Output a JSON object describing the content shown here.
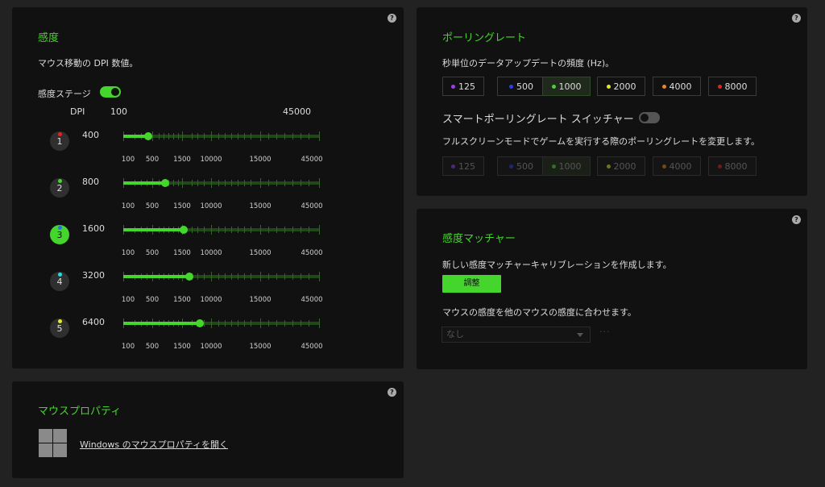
{
  "sensitivity": {
    "title": "感度",
    "description": "マウス移動の DPI 数値。",
    "stages_label": "感度ステージ",
    "stages_enabled": true,
    "dpi_header": "DPI",
    "range_min": "100",
    "range_max": "45000",
    "tick_labels": [
      "100",
      "500",
      "1500",
      "10000",
      "15000",
      "45000"
    ],
    "stages": [
      {
        "number": "1",
        "dpi": "400",
        "color": "#e02424",
        "active": false
      },
      {
        "number": "2",
        "dpi": "800",
        "color": "#44d62c",
        "active": false
      },
      {
        "number": "3",
        "dpi": "1600",
        "color": "#2f6de0",
        "active": true
      },
      {
        "number": "4",
        "dpi": "3200",
        "color": "#2fd6e0",
        "active": false
      },
      {
        "number": "5",
        "dpi": "6400",
        "color": "#e6e62c",
        "active": false
      }
    ]
  },
  "polling": {
    "title": "ポーリングレート",
    "description": "秒単位のデータアップデートの頻度 (Hz)。",
    "rates": [
      {
        "label": "125",
        "color": "#9b3fe6"
      },
      {
        "label": "500",
        "color": "#2f3fe6"
      },
      {
        "label": "1000",
        "color": "#44d62c"
      },
      {
        "label": "2000",
        "color": "#e6e62c"
      },
      {
        "label": "4000",
        "color": "#e6882c"
      },
      {
        "label": "8000",
        "color": "#e02424"
      }
    ],
    "selected": "1000",
    "smart_switcher_label": "スマートポーリングレート スイッチャー",
    "smart_switcher_enabled": false,
    "smart_description": "フルスクリーンモードでゲームを実行する際のポーリングレートを変更します。"
  },
  "matcher": {
    "title": "感度マッチャー",
    "description": "新しい感度マッチャーキャリブレーションを作成します。",
    "adjust_label": "調整",
    "match_description": "マウスの感度を他のマウスの感度に合わせます。",
    "select_value": "なし",
    "more_label": "···"
  },
  "mouse_props": {
    "title": "マウスプロパティ",
    "link": "Windows のマウスプロパティを開く"
  },
  "help_label": "?"
}
